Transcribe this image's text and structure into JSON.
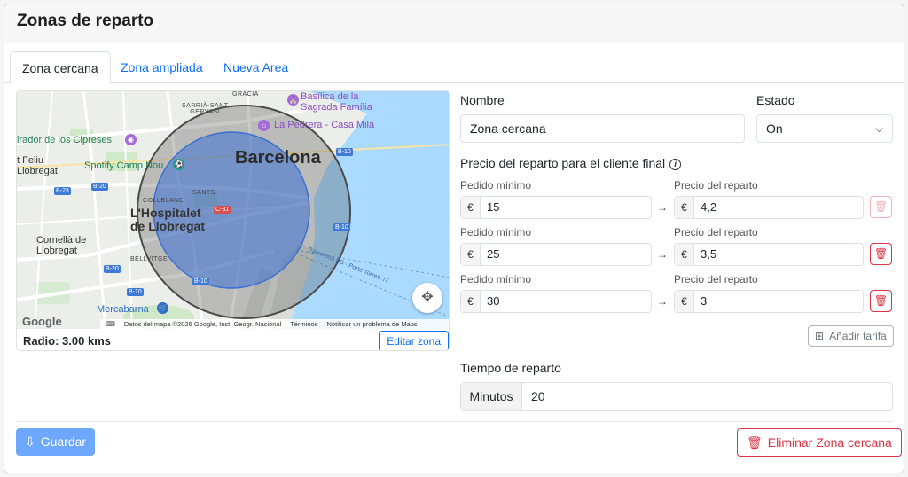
{
  "header": {
    "title": "Zonas de reparto"
  },
  "tabs": [
    {
      "label": "Zona cercana",
      "active": true
    },
    {
      "label": "Zona ampliada",
      "active": false
    },
    {
      "label": "Nueva Area",
      "active": false
    }
  ],
  "map": {
    "labels": {
      "city": "Barcelona",
      "hospitalet": "L'Hospitalet\nde Llobregat",
      "cornella": "Cornellà de\nLlobregat",
      "sant_feliu": "t Feliu\nLlobregat",
      "gracia": "GRÀCIA",
      "sarria": "SARRIÀ-SANT\nGERVASI",
      "sants": "SANTS",
      "collblanc": "COLLBLANC",
      "bellvitge": "BELLVITGE",
      "mirador": "irador de los Cipreses",
      "spotify": "Spotify Camp Nou",
      "sagrada": "Basílica de la\nSagrada Família",
      "pedrera": "La Pedrera - Casa Milà",
      "mercabarna": "Mercabarna",
      "port": "Barcelona ES - Porto Torres, IT"
    },
    "road_tags": [
      "B-23",
      "B-20",
      "B-20",
      "B-10",
      "B-10",
      "C-31",
      "B-10",
      "B-10"
    ],
    "google_logo": "Google",
    "attribution": {
      "data": "Datos del mapa ©2026 Google, Inst. Geogr. Nacional",
      "terms": "Términos",
      "report": "Notificar un problema de Maps"
    },
    "radius_text": "Radio: 3.00 kms",
    "edit_label": "Editar zona"
  },
  "form": {
    "name_label": "Nombre",
    "name_value": "Zona cercana",
    "status_label": "Estado",
    "status_value": "On",
    "pricing_title": "Precio del reparto para el cliente final",
    "min_order_label": "Pedido mínimo",
    "delivery_price_label": "Precio del reparto",
    "currency": "€",
    "rates": [
      {
        "min_order": "15",
        "price": "4,2"
      },
      {
        "min_order": "25",
        "price": "3,5"
      },
      {
        "min_order": "30",
        "price": "3"
      }
    ],
    "add_rate_label": "Añadir tarifa",
    "time_label": "Tiempo de reparto",
    "minutes_label": "Minutos",
    "minutes_value": "20"
  },
  "actions": {
    "save_label": "Guardar",
    "delete_label": "Eliminar Zona cercana"
  },
  "colors": {
    "primary": "#0d6efd",
    "primary_light": "#6ea8fe",
    "danger": "#dc3545",
    "water": "#aadaff",
    "zone_fill": "#3b6fd1"
  }
}
